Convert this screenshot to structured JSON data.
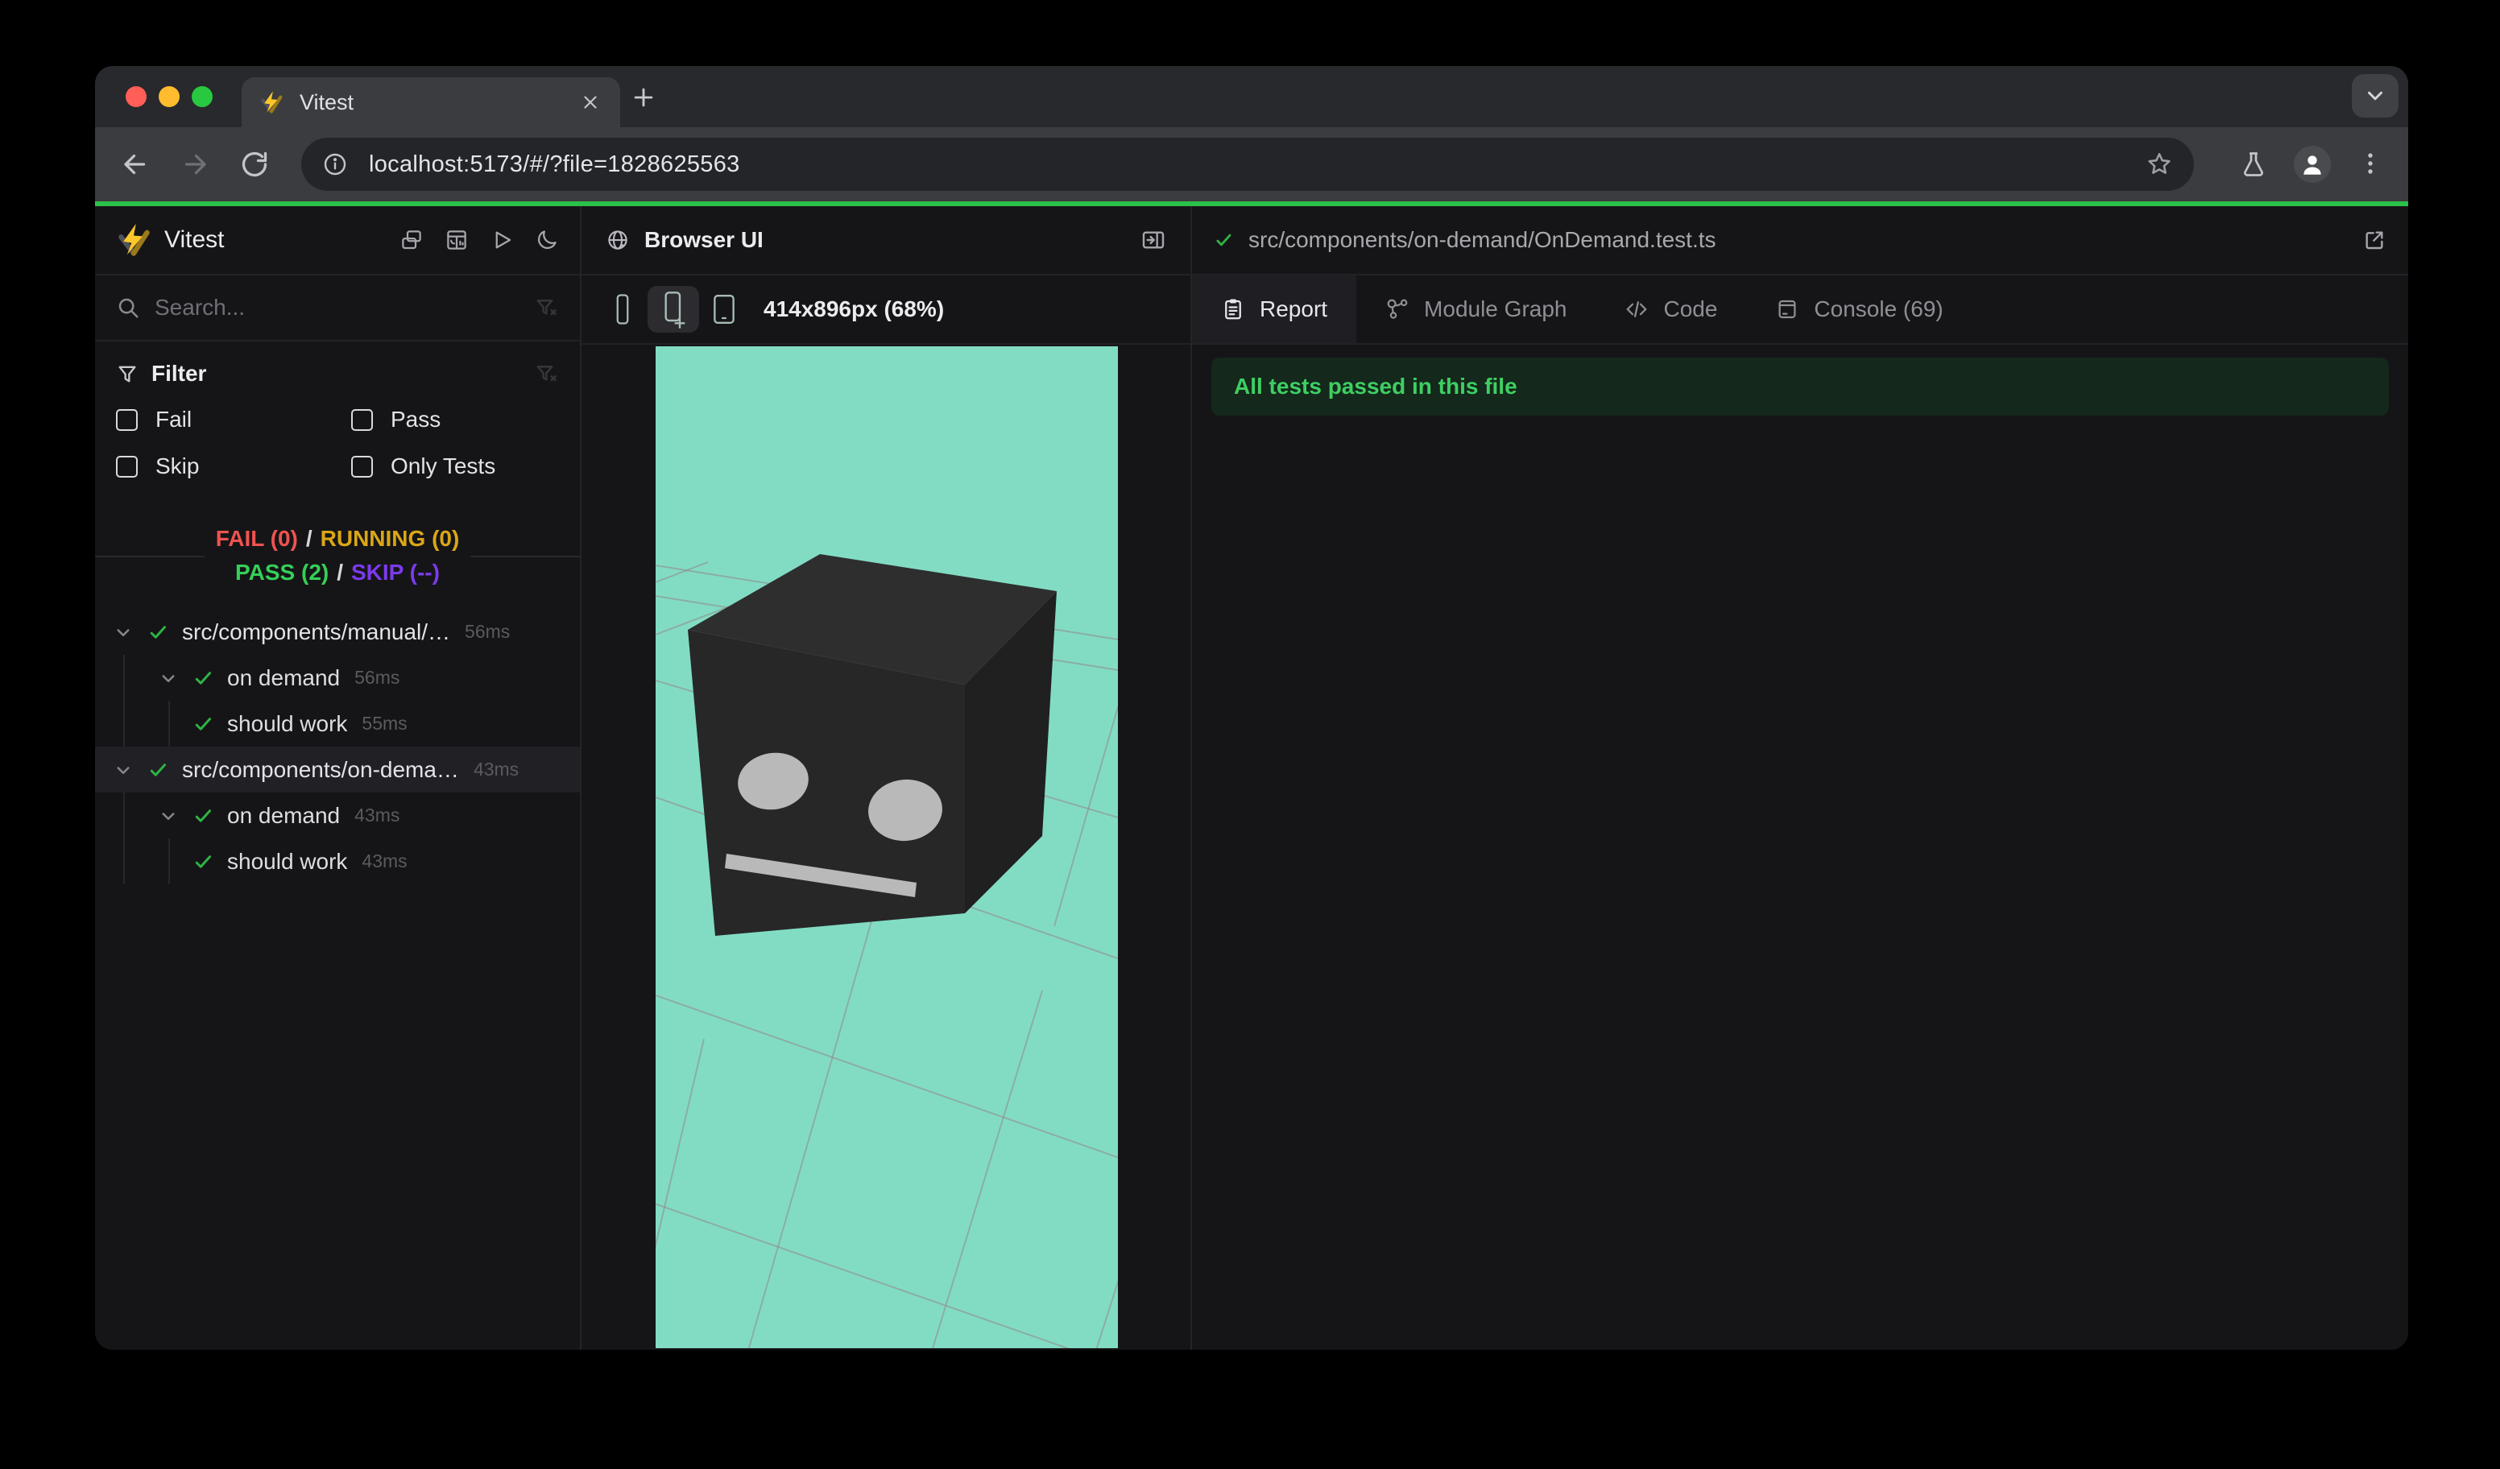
{
  "window": {
    "tab_title": "Vitest",
    "url": "localhost:5173/#/?file=1828625563"
  },
  "sidebar": {
    "app_title": "Vitest",
    "search_placeholder": "Search...",
    "filter_title": "Filter",
    "filter_options": [
      "Fail",
      "Pass",
      "Skip",
      "Only Tests"
    ],
    "summary": {
      "fail": "FAIL (0)",
      "running": "RUNNING (0)",
      "pass": "PASS (2)",
      "skip": "SKIP (--)",
      "sep": "/"
    },
    "tree": [
      {
        "label": "src/components/manual/…",
        "duration": "56ms",
        "level": 0,
        "chevron": true,
        "selected": false
      },
      {
        "label": "on demand",
        "duration": "56ms",
        "level": 1,
        "chevron": true,
        "selected": false
      },
      {
        "label": "should work",
        "duration": "55ms",
        "level": 2,
        "chevron": false,
        "selected": false
      },
      {
        "label": "src/components/on-dema…",
        "duration": "43ms",
        "level": 0,
        "chevron": true,
        "selected": true
      },
      {
        "label": "on demand",
        "duration": "43ms",
        "level": 1,
        "chevron": true,
        "selected": false
      },
      {
        "label": "should work",
        "duration": "43ms",
        "level": 2,
        "chevron": false,
        "selected": false
      }
    ]
  },
  "browser_panel": {
    "title": "Browser UI",
    "viewport_label": "414x896px (68%)"
  },
  "report_panel": {
    "file_path": "src/components/on-demand/OnDemand.test.ts",
    "tabs": [
      {
        "label": "Report",
        "active": true
      },
      {
        "label": "Module Graph",
        "active": false
      },
      {
        "label": "Code",
        "active": false
      },
      {
        "label": "Console (69)",
        "active": false
      }
    ],
    "banner": "All tests passed in this file"
  },
  "colors": {
    "fail": "#ef5350",
    "running": "#dba617",
    "pass": "#34d058",
    "skip": "#7c3aed",
    "check": "#2fb344",
    "loadbar": "#2bc24a",
    "mint": "#82dcc4",
    "grid_line": "#93868d",
    "cube_top": "#2e2e2e",
    "cube_front": "#272727",
    "cube_side": "#202020",
    "cube_face": "#b9b9b9",
    "banner_bg": "#14281b",
    "banner_text": "#3ecf63"
  }
}
